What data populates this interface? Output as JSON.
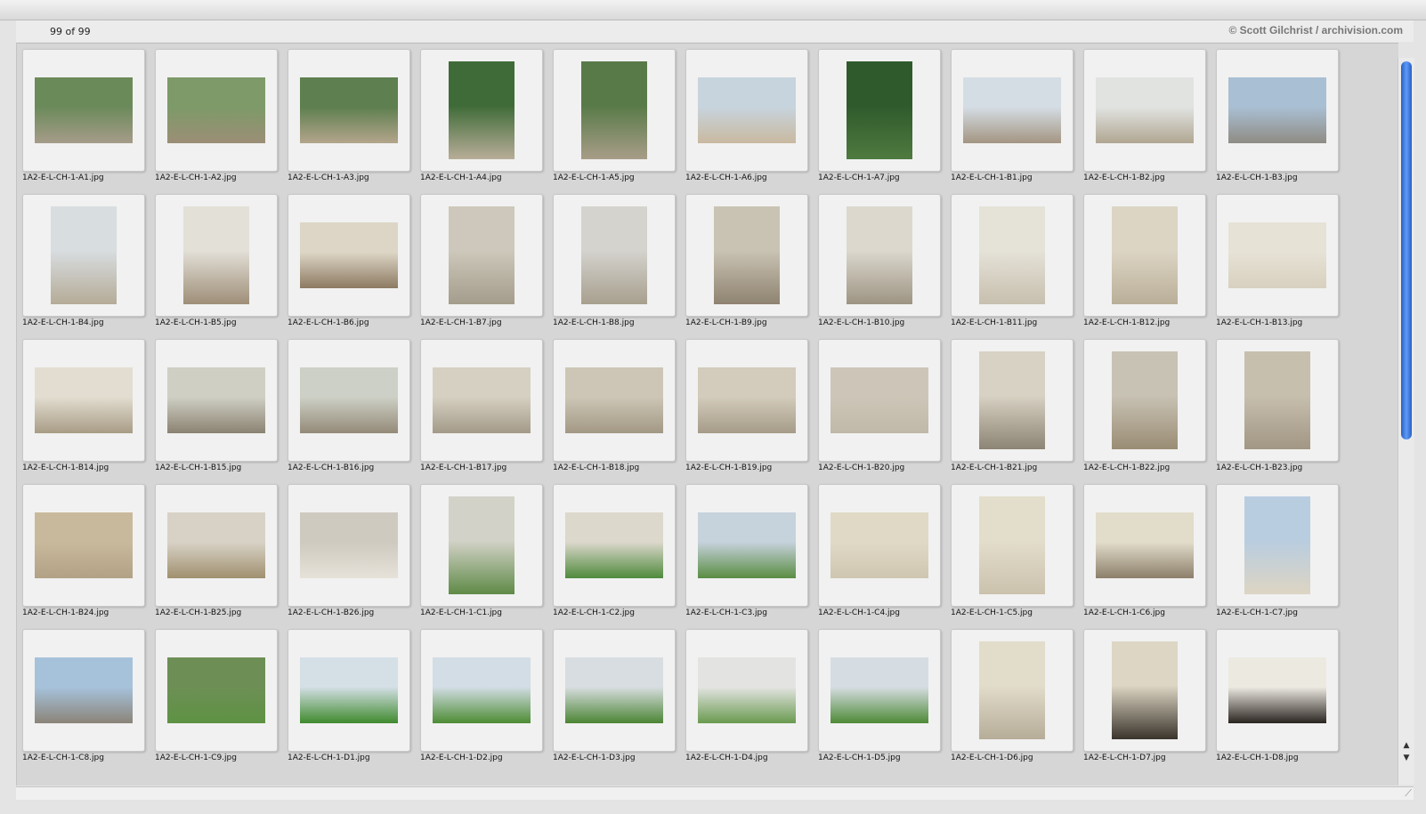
{
  "header": {
    "counter": "99 of 99",
    "copyright": "© Scott Gilchrist / archivision.com"
  },
  "thumbnails": [
    {
      "name": "1A2-E-L-CH-1-A1.jpg",
      "orientation": "landscape",
      "top": "#6b8a5a",
      "bottom": "#a69c8a"
    },
    {
      "name": "1A2-E-L-CH-1-A2.jpg",
      "orientation": "landscape",
      "top": "#7d9a68",
      "bottom": "#9c8e76"
    },
    {
      "name": "1A2-E-L-CH-1-A3.jpg",
      "orientation": "landscape",
      "top": "#5e7f4f",
      "bottom": "#b4a58c"
    },
    {
      "name": "1A2-E-L-CH-1-A4.jpg",
      "orientation": "portrait",
      "top": "#3f6b38",
      "bottom": "#b8ad98"
    },
    {
      "name": "1A2-E-L-CH-1-A5.jpg",
      "orientation": "portrait",
      "top": "#587a48",
      "bottom": "#a89d88"
    },
    {
      "name": "1A2-E-L-CH-1-A6.jpg",
      "orientation": "landscape",
      "top": "#c7d4dd",
      "bottom": "#c9b9a0"
    },
    {
      "name": "1A2-E-L-CH-1-A7.jpg",
      "orientation": "portrait",
      "top": "#2f5a2c",
      "bottom": "#4f7a3f"
    },
    {
      "name": "1A2-E-L-CH-1-B1.jpg",
      "orientation": "landscape",
      "top": "#d5dde4",
      "bottom": "#a39582"
    },
    {
      "name": "1A2-E-L-CH-1-B2.jpg",
      "orientation": "landscape",
      "top": "#e1e3e1",
      "bottom": "#b0a691"
    },
    {
      "name": "1A2-E-L-CH-1-B3.jpg",
      "orientation": "landscape",
      "top": "#a9bfd3",
      "bottom": "#8f8c84"
    },
    {
      "name": "1A2-E-L-CH-1-B4.jpg",
      "orientation": "portrait",
      "top": "#d8dde0",
      "bottom": "#b5ab97"
    },
    {
      "name": "1A2-E-L-CH-1-B5.jpg",
      "orientation": "portrait",
      "top": "#e3e0d8",
      "bottom": "#9e8e78"
    },
    {
      "name": "1A2-E-L-CH-1-B6.jpg",
      "orientation": "landscape",
      "top": "#ddd6c6",
      "bottom": "#8d7a62"
    },
    {
      "name": "1A2-E-L-CH-1-B7.jpg",
      "orientation": "portrait",
      "top": "#cdc8bb",
      "bottom": "#a49c8c"
    },
    {
      "name": "1A2-E-L-CH-1-B8.jpg",
      "orientation": "portrait",
      "top": "#d4d3ce",
      "bottom": "#a89f8e"
    },
    {
      "name": "1A2-E-L-CH-1-B9.jpg",
      "orientation": "portrait",
      "top": "#c9c3b4",
      "bottom": "#8f8270"
    },
    {
      "name": "1A2-E-L-CH-1-B10.jpg",
      "orientation": "portrait",
      "top": "#dcd8ce",
      "bottom": "#9d9483"
    },
    {
      "name": "1A2-E-L-CH-1-B11.jpg",
      "orientation": "portrait",
      "top": "#e5e2d8",
      "bottom": "#c7bfae"
    },
    {
      "name": "1A2-E-L-CH-1-B12.jpg",
      "orientation": "portrait",
      "top": "#ddd5c4",
      "bottom": "#b9ae98"
    },
    {
      "name": "1A2-E-L-CH-1-B13.jpg",
      "orientation": "landscape",
      "top": "#e6e2d6",
      "bottom": "#d8d0bf"
    },
    {
      "name": "1A2-E-L-CH-1-B14.jpg",
      "orientation": "landscape",
      "top": "#e2ddd0",
      "bottom": "#a89c86"
    },
    {
      "name": "1A2-E-L-CH-1-B15.jpg",
      "orientation": "landscape",
      "top": "#cfcfc4",
      "bottom": "#8b8272"
    },
    {
      "name": "1A2-E-L-CH-1-B16.jpg",
      "orientation": "landscape",
      "top": "#cdd0c6",
      "bottom": "#948a78"
    },
    {
      "name": "1A2-E-L-CH-1-B17.jpg",
      "orientation": "landscape",
      "top": "#d6d0c2",
      "bottom": "#a39a88"
    },
    {
      "name": "1A2-E-L-CH-1-B18.jpg",
      "orientation": "landscape",
      "top": "#cdc6b6",
      "bottom": "#a29884"
    },
    {
      "name": "1A2-E-L-CH-1-B19.jpg",
      "orientation": "landscape",
      "top": "#d3cbbb",
      "bottom": "#a59b88"
    },
    {
      "name": "1A2-E-L-CH-1-B20.jpg",
      "orientation": "landscape",
      "top": "#cdc6b8",
      "bottom": "#c0b8a8"
    },
    {
      "name": "1A2-E-L-CH-1-B21.jpg",
      "orientation": "portrait",
      "top": "#d8d2c4",
      "bottom": "#8c8474"
    },
    {
      "name": "1A2-E-L-CH-1-B22.jpg",
      "orientation": "portrait",
      "top": "#c8c2b4",
      "bottom": "#9a8c74"
    },
    {
      "name": "1A2-E-L-CH-1-B23.jpg",
      "orientation": "portrait",
      "top": "#c7bfae",
      "bottom": "#a29684"
    },
    {
      "name": "1A2-E-L-CH-1-B24.jpg",
      "orientation": "landscape",
      "top": "#c9b99c",
      "bottom": "#b2a185"
    },
    {
      "name": "1A2-E-L-CH-1-B25.jpg",
      "orientation": "landscape",
      "top": "#d8d2c6",
      "bottom": "#a0906f"
    },
    {
      "name": "1A2-E-L-CH-1-B26.jpg",
      "orientation": "landscape",
      "top": "#cfcac0",
      "bottom": "#e6e2d9"
    },
    {
      "name": "1A2-E-L-CH-1-C1.jpg",
      "orientation": "portrait",
      "top": "#d3d2c8",
      "bottom": "#5f8a47"
    },
    {
      "name": "1A2-E-L-CH-1-C2.jpg",
      "orientation": "landscape",
      "top": "#dcd8cc",
      "bottom": "#4f8a3c"
    },
    {
      "name": "1A2-E-L-CH-1-C3.jpg",
      "orientation": "landscape",
      "top": "#c6d2dc",
      "bottom": "#5a8d43"
    },
    {
      "name": "1A2-E-L-CH-1-C4.jpg",
      "orientation": "landscape",
      "top": "#e0d9c6",
      "bottom": "#cfc6b0"
    },
    {
      "name": "1A2-E-L-CH-1-C5.jpg",
      "orientation": "portrait",
      "top": "#e3ddcc",
      "bottom": "#cbc2ad"
    },
    {
      "name": "1A2-E-L-CH-1-C6.jpg",
      "orientation": "landscape",
      "top": "#e2dccb",
      "bottom": "#8c7f6a"
    },
    {
      "name": "1A2-E-L-CH-1-C7.jpg",
      "orientation": "portrait",
      "top": "#b9cde0",
      "bottom": "#ddd5c3"
    },
    {
      "name": "1A2-E-L-CH-1-C8.jpg",
      "orientation": "landscape",
      "top": "#a6c2db",
      "bottom": "#8b8478"
    },
    {
      "name": "1A2-E-L-CH-1-C9.jpg",
      "orientation": "landscape",
      "top": "#6d8f55",
      "bottom": "#5e9243"
    },
    {
      "name": "1A2-E-L-CH-1-D1.jpg",
      "orientation": "landscape",
      "top": "#d4dfe6",
      "bottom": "#3f8a2e"
    },
    {
      "name": "1A2-E-L-CH-1-D2.jpg",
      "orientation": "landscape",
      "top": "#d2dde5",
      "bottom": "#4d8c34"
    },
    {
      "name": "1A2-E-L-CH-1-D3.jpg",
      "orientation": "landscape",
      "top": "#d7dde0",
      "bottom": "#4c8535"
    },
    {
      "name": "1A2-E-L-CH-1-D4.jpg",
      "orientation": "landscape",
      "top": "#e3e4e2",
      "bottom": "#6a9a4f"
    },
    {
      "name": "1A2-E-L-CH-1-D5.jpg",
      "orientation": "landscape",
      "top": "#d6dde2",
      "bottom": "#4e8a37"
    },
    {
      "name": "1A2-E-L-CH-1-D6.jpg",
      "orientation": "portrait",
      "top": "#e2dccb",
      "bottom": "#b6ad98"
    },
    {
      "name": "1A2-E-L-CH-1-D7.jpg",
      "orientation": "portrait",
      "top": "#ddd6c4",
      "bottom": "#3a342c"
    },
    {
      "name": "1A2-E-L-CH-1-D8.jpg",
      "orientation": "landscape",
      "top": "#ece9e1",
      "bottom": "#2a2520"
    }
  ]
}
